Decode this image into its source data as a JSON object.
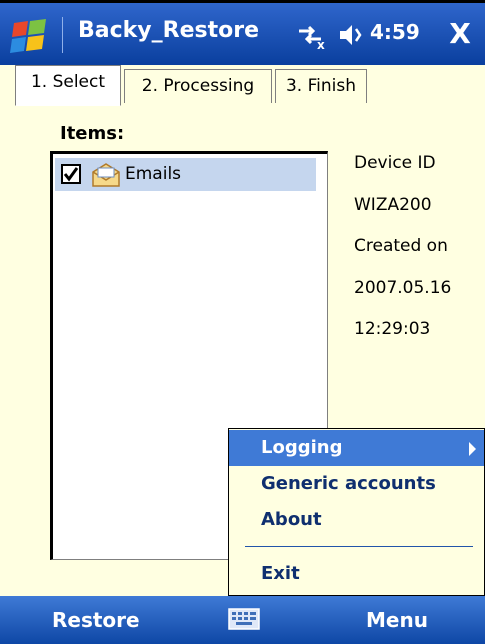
{
  "titlebar": {
    "title": "Backy_Restore",
    "time": "4:59",
    "close_label": "X",
    "icons": [
      "windows-start-icon",
      "connectivity-icon",
      "volume-icon"
    ]
  },
  "tabs": [
    {
      "label": "1. Select",
      "active": true
    },
    {
      "label": "2. Processing",
      "active": false
    },
    {
      "label": "3. Finish",
      "active": false
    }
  ],
  "content": {
    "items_label": "Items:",
    "list_items": [
      {
        "label": "Emails",
        "checked": true,
        "icon": "email-icon"
      }
    ],
    "info_lines": [
      "Device ID",
      "WIZA200",
      "Created on",
      "2007.05.16",
      "12:29:03"
    ]
  },
  "menu": {
    "items": [
      {
        "label": "Logging",
        "selected": true,
        "has_submenu": true
      },
      {
        "label": "Generic accounts",
        "selected": false
      },
      {
        "label": "About",
        "selected": false
      },
      {
        "label": "Exit",
        "selected": false
      }
    ]
  },
  "softkeys": {
    "left": "Restore",
    "right": "Menu"
  },
  "colors": {
    "titlebar": "#0a3f9e",
    "background": "#ffffe1",
    "menu_highlight": "#3f7ad6",
    "list_selection": "#c5d6ee"
  }
}
